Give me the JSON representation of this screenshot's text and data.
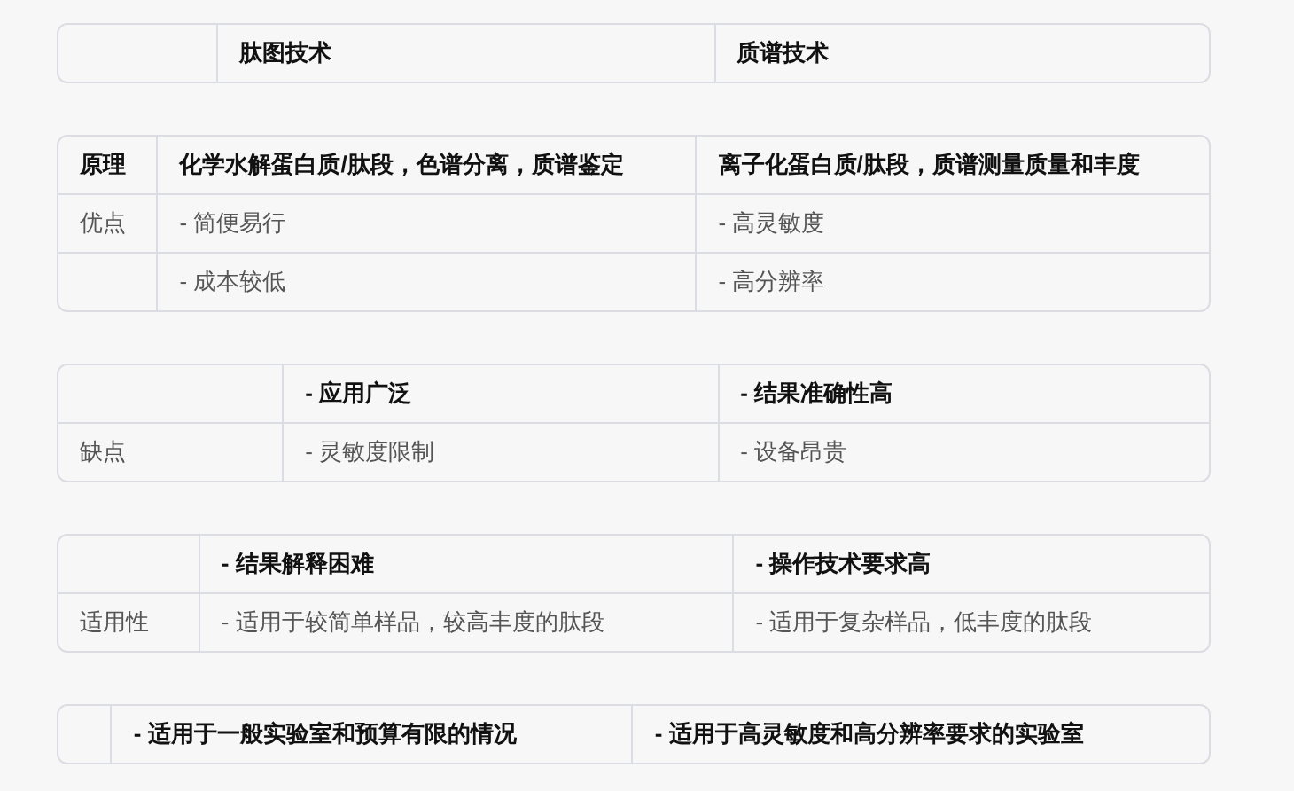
{
  "tables": [
    {
      "header": {
        "cells": [
          "肽图技术",
          "质谱技术"
        ]
      }
    },
    {
      "header": {
        "label": "原理",
        "cells": [
          "化学水解蛋白质/肽段，色谱分离，质谱鉴定",
          "离子化蛋白质/肽段，质谱测量质量和丰度"
        ]
      },
      "rows": [
        {
          "label": "优点",
          "cells": [
            "- 简便易行",
            "- 高灵敏度"
          ]
        },
        {
          "cells": [
            "- 成本较低",
            "- 高分辨率"
          ]
        }
      ]
    },
    {
      "header": {
        "cells": [
          "- 应用广泛",
          "- 结果准确性高"
        ]
      },
      "rows": [
        {
          "label": "缺点",
          "cells": [
            "- 灵敏度限制",
            "- 设备昂贵"
          ]
        }
      ]
    },
    {
      "header": {
        "cells": [
          "- 结果解释困难",
          "- 操作技术要求高"
        ]
      },
      "rows": [
        {
          "label": "适用性",
          "cells": [
            "- 适用于较简单样品，较高丰度的肽段",
            "- 适用于复杂样品，低丰度的肽段"
          ]
        }
      ]
    },
    {
      "header": {
        "cells": [
          "- 适用于一般实验室和预算有限的情况",
          "- 适用于高灵敏度和高分辨率要求的实验室"
        ]
      }
    }
  ]
}
